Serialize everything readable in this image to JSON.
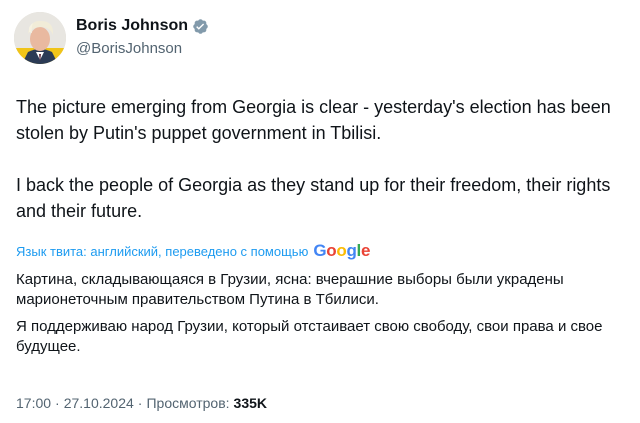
{
  "author": {
    "display_name": "Boris Johnson",
    "handle": "@BorisJohnson",
    "verified_icon": "verified-badge-icon"
  },
  "tweet": {
    "paragraphs": [
      "The picture emerging from Georgia is clear - yesterday's election has been stolen by Putin's puppet government in Tbilisi.",
      "I back the people of Georgia as they stand up for their freedom, their rights and their future."
    ]
  },
  "translation": {
    "label": "Язык твита: английский, переведено с помощью",
    "provider_letters": [
      "G",
      "o",
      "o",
      "g",
      "l",
      "e"
    ],
    "provider_colors": [
      "#4285f4",
      "#ea4335",
      "#fbbc05",
      "#4285f4",
      "#34a853",
      "#ea4335"
    ],
    "paragraphs": [
      "Картина, складывающаяся в Грузии, ясна: вчерашние выборы были украдены марионеточным правительством Путина в Тбилиси.",
      "Я поддерживаю народ Грузии, который отстаивает свою свободу, свои права и свое будущее."
    ]
  },
  "meta": {
    "time": "17:00",
    "date": "27.10.2024",
    "separator": "·",
    "views_label": "Просмотров:",
    "views_count": "335K"
  },
  "colors": {
    "accent": "#1d9bf0",
    "text": "#0f1419",
    "secondary": "#536471"
  }
}
